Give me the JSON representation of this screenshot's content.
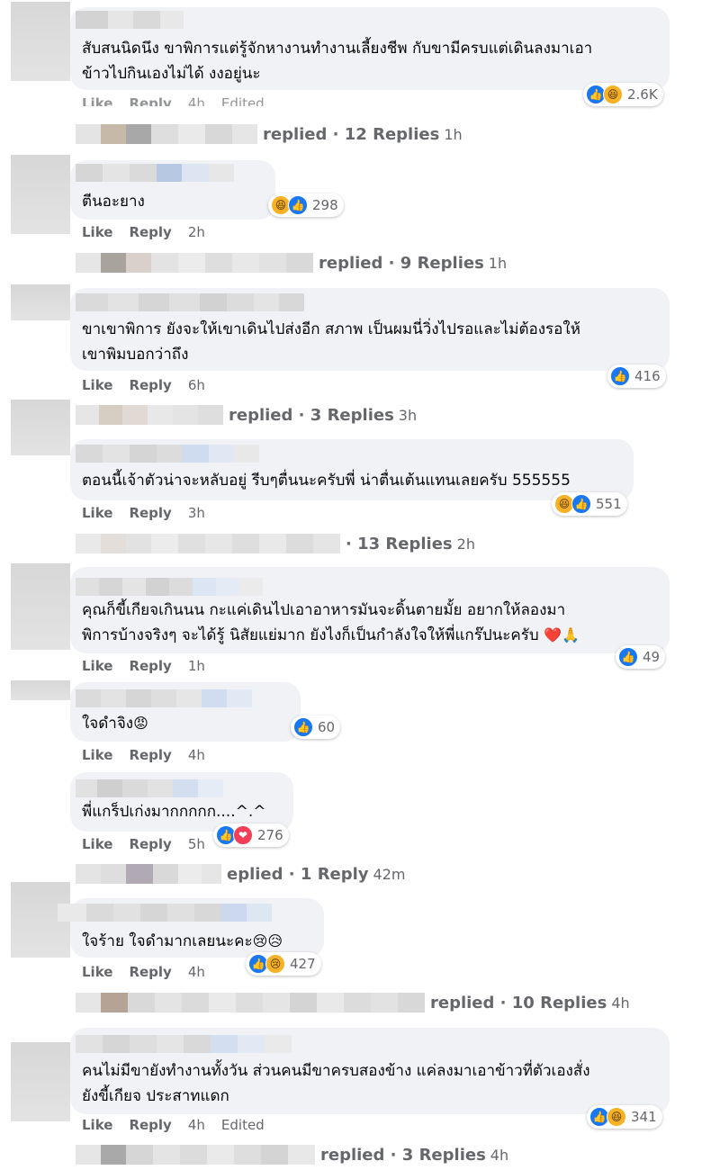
{
  "comments": [
    {
      "text1": "สับสนนิดนึง ขาพิการแต่รู้จักหางานทำงานเลี้ยงชีพ กับขามีครบแต่เดินลงมาเอา",
      "text2": "ข้าวไปกินเองไม่ได้ งงอยู่นะ",
      "like": "Like",
      "reply": "Reply",
      "time": "4h",
      "edited": "Edited",
      "reactions": [
        "like",
        "haha"
      ],
      "count": "2.6K",
      "replies_label": "replied · 12 Replies",
      "replies_time": "1h"
    },
    {
      "text1": "ตีนอะยาง",
      "like": "Like",
      "reply": "Reply",
      "time": "2h",
      "reactions": [
        "haha",
        "like"
      ],
      "count": "298",
      "replies_label": "replied · 9 Replies",
      "replies_time": "1h"
    },
    {
      "text1": "ขาเขาพิการ ยังจะให้เขาเดินไปส่งอีก สภาพ เป็นผมนี่วิ่งไปรอและไม่ต้องรอให้",
      "text2": "เขาพิมบอกว่าถึง",
      "like": "Like",
      "reply": "Reply",
      "time": "6h",
      "reactions": [
        "like"
      ],
      "count": "416",
      "replies_label": "replied · 3 Replies",
      "replies_time": "3h"
    },
    {
      "text1": "ตอนนี้เจ้าตัวน่าจะหลับอยู่ รีบๆตื่นนะครับพี่ น่าตื่นเต้นแทนเลยครับ 555555",
      "like": "Like",
      "reply": "Reply",
      "time": "3h",
      "reactions": [
        "haha",
        "like"
      ],
      "count": "551",
      "replies_label": "· 13 Replies",
      "replies_time": "2h"
    },
    {
      "text1": "คุณก็ขี้เกียจเกินนน กะแค่เดินไปเอาอาหารมันจะดิ้นตายมั้ย อยากให้ลองมา",
      "text2": "พิการบ้างจริงๆ จะได้รู้ นิสัยแย่มาก ยังไงก็เป็นกำลังใจให้พี่แกร๊ปนะครับ",
      "text2_emoji": "❤️🙏",
      "like": "Like",
      "reply": "Reply",
      "time": "1h",
      "reactions": [
        "like"
      ],
      "count": "49"
    },
    {
      "text1": "ใจดำจิง",
      "text1_emoji": "😡",
      "like": "Like",
      "reply": "Reply",
      "time": "4h",
      "reactions": [
        "like"
      ],
      "count": "60"
    },
    {
      "text1": "พี่แกร็ปเก่งมากกกกก....^.^",
      "like": "Like",
      "reply": "Reply",
      "time": "5h",
      "reactions": [
        "like",
        "love"
      ],
      "count": "276",
      "replies_label": "eplied · 1 Reply",
      "replies_time": "42m"
    },
    {
      "text1": "ใจร้าย ใจดำมากเลยนะคะ",
      "text1_emoji": "😢😥",
      "like": "Like",
      "reply": "Reply",
      "time": "4h",
      "reactions": [
        "like",
        "sad"
      ],
      "count": "427",
      "replies_label": "replied · 10 Replies",
      "replies_time": "4h"
    },
    {
      "text1": "คนไม่มีขายังทำงานทั้งวัน ส่วนคนมีขาครบสองข้าง แค่ลงมาเอาข้าวที่ตัวเองสั่ง",
      "text2": "ยังขี้เกียจ ประสาทแดก",
      "like": "Like",
      "reply": "Reply",
      "time": "4h",
      "edited": "Edited",
      "reactions": [
        "like",
        "haha"
      ],
      "count": "341",
      "replies_label": "replied · 3 Replies",
      "replies_time": "4h"
    }
  ],
  "reaction_icons": {
    "like": "👍",
    "haha": "😆",
    "love": "❤",
    "sad": "😢",
    "angry": "😡"
  },
  "colors": {
    "bubble": "#f0f2f5",
    "meta": "#65676b",
    "like": "#1877f2"
  }
}
